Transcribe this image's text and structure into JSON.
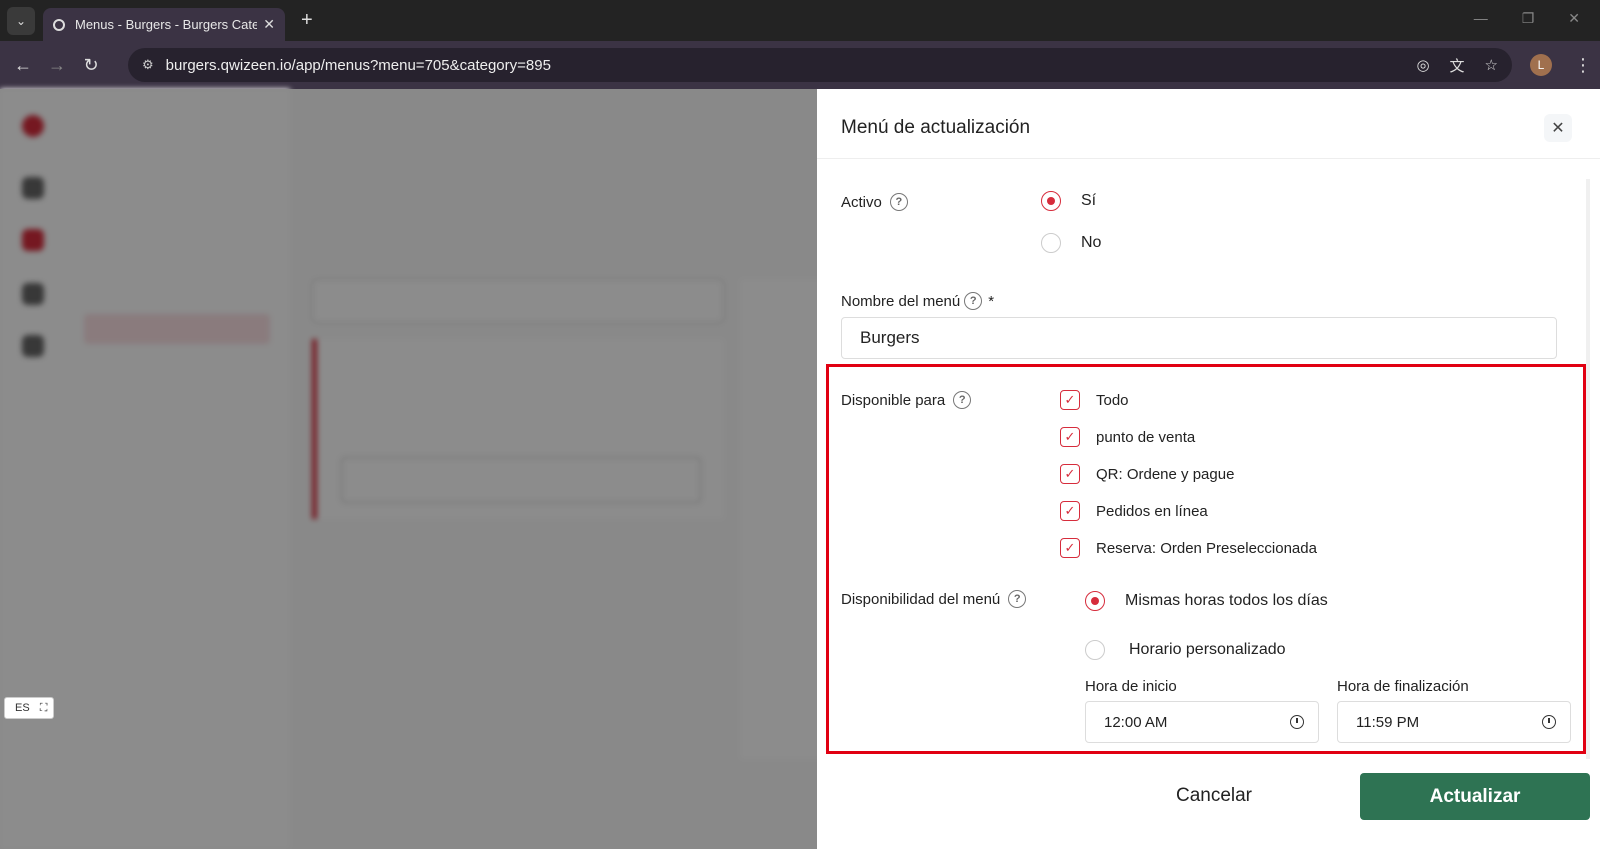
{
  "browser": {
    "tab_title": "Menus - Burgers - Burgers Cate",
    "url": "burgers.qwizeen.io/app/menus?menu=705&category=895",
    "avatar_letter": "L"
  },
  "lang_badge": "ES",
  "drawer": {
    "title": "Menú de actualización",
    "active": {
      "label": "Activo",
      "options": [
        "Sí",
        "No"
      ],
      "selected": "Sí"
    },
    "menu_name": {
      "label": "Nombre del menú",
      "required_mark": "*",
      "value": "Burgers"
    },
    "available_for": {
      "label": "Disponible para",
      "options": [
        {
          "label": "Todo",
          "checked": true
        },
        {
          "label": "punto de venta",
          "checked": true
        },
        {
          "label": "QR: Ordene y pague",
          "checked": true
        },
        {
          "label": "Pedidos en línea",
          "checked": true
        },
        {
          "label": "Reserva: Orden Preseleccionada",
          "checked": true
        }
      ]
    },
    "availability": {
      "label": "Disponibilidad del menú",
      "options": [
        "Mismas horas todos los días",
        "Horario personalizado"
      ],
      "selected": "Mismas horas todos los días",
      "start_label": "Hora de inicio",
      "start_value": "12:00 AM",
      "end_label": "Hora de finalización",
      "end_value": "11:59 PM"
    },
    "cancel_label": "Cancelar",
    "update_label": "Actualizar"
  },
  "colors": {
    "accent": "#d62c3c",
    "primary_button": "#2e7353",
    "highlight_box": "#e10012"
  }
}
